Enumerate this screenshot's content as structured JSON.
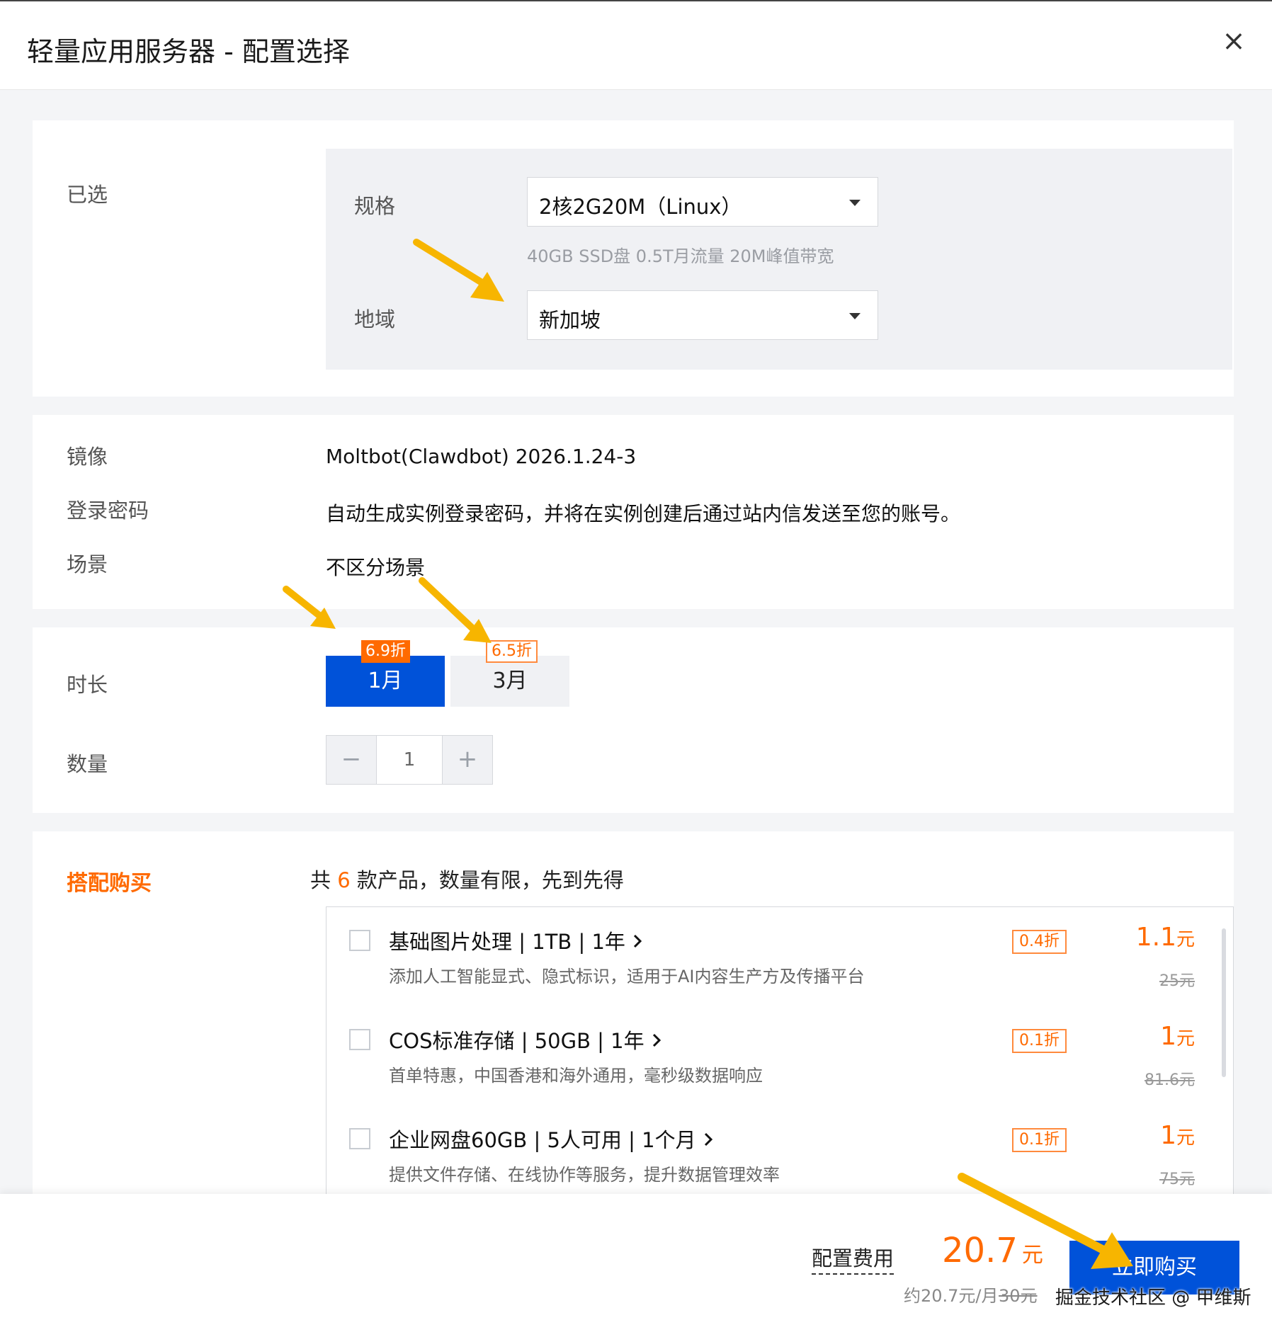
{
  "header": {
    "title": "轻量应用服务器 - 配置选择",
    "close_icon": "×"
  },
  "selected": {
    "section_label": "已选",
    "spec": {
      "label": "规格",
      "value": "2核2G20M（Linux）",
      "hint": "40GB SSD盘 0.5T月流量 20M峰值带宽"
    },
    "region": {
      "label": "地域",
      "value": "新加坡"
    }
  },
  "info": {
    "image_label": "镜像",
    "image_value": "Moltbot(Clawdbot) 2026.1.24-3",
    "password_label": "登录密码",
    "password_value": "自动生成实例登录密码，并将在实例创建后通过站内信发送至您的账号。",
    "scene_label": "场景",
    "scene_value": "不区分场景"
  },
  "duration": {
    "label": "时长",
    "options": [
      {
        "label": "1月",
        "badge": "6.9折",
        "selected": true
      },
      {
        "label": "3月",
        "badge": "6.5折",
        "selected": false
      }
    ]
  },
  "quantity": {
    "label": "数量",
    "minus": "−",
    "value": "1",
    "plus": "+"
  },
  "bundle": {
    "title": "搭配购买",
    "subtitle_prefix": "共 ",
    "count": "6",
    "subtitle_suffix": " 款产品，数量有限，先到先得",
    "items": [
      {
        "name": "基础图片处理 | 1TB | 1年",
        "desc": "添加人工智能显式、隐式标识，适用于AI内容生产方及传播平台",
        "badge": "0.4折",
        "price": "1.1",
        "unit": "元",
        "original": "25元"
      },
      {
        "name": "COS标准存储 | 50GB | 1年",
        "desc": "首单特惠，中国香港和海外通用，毫秒级数据响应",
        "badge": "0.1折",
        "price": "1",
        "unit": "元",
        "original": "81.6元"
      },
      {
        "name": "企业网盘60GB | 5人可用 | 1个月",
        "desc": "提供文件存储、在线协作等服务，提升数据管理效率",
        "badge": "0.1折",
        "price": "1",
        "unit": "元",
        "original": "75元"
      }
    ]
  },
  "footer": {
    "fee_label": "配置费用",
    "fee_amount": "20.7",
    "fee_unit": "元",
    "fee_per_month": "约20.7元/月",
    "fee_original": "30元",
    "buy_label": "立即购买",
    "watermark": "掘金技术社区 @ 甲维斯"
  },
  "colors": {
    "primary": "#0052d9",
    "accent": "#ff6a00",
    "annotation_arrow": "#f7b500"
  },
  "icons": {
    "close": "close-icon",
    "caret": "caret-down-icon",
    "chevron": "chevron-right-icon",
    "arrow": "annotation-arrow-icon"
  }
}
